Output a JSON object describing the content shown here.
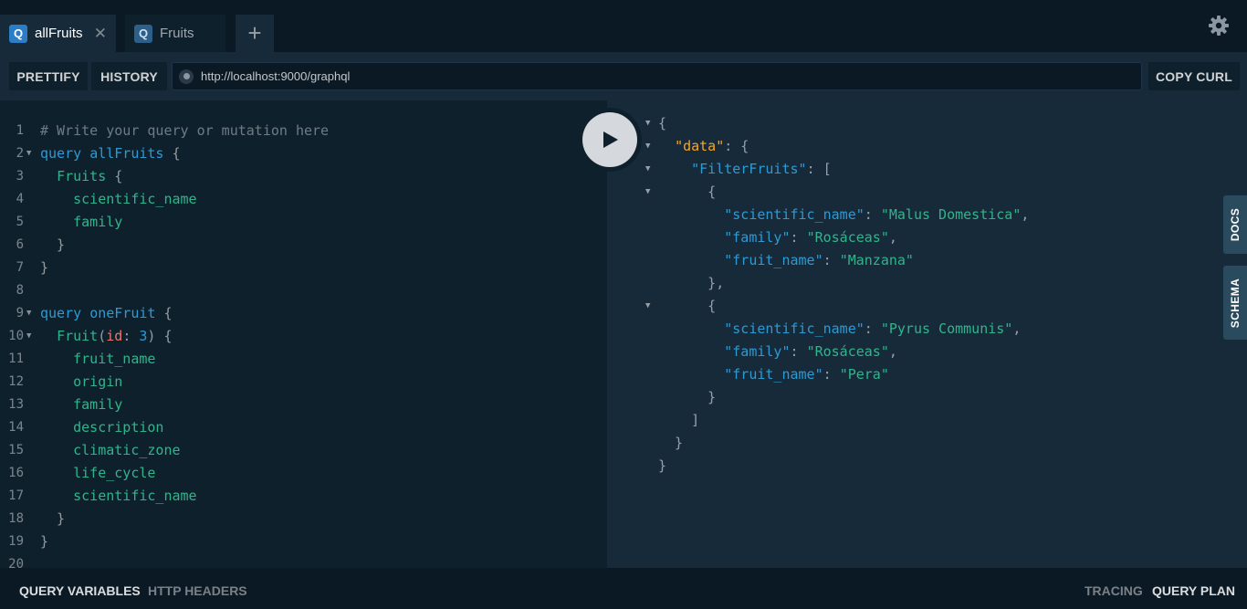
{
  "tabs": [
    {
      "badge": "Q",
      "label": "allFruits",
      "close": "✕"
    },
    {
      "badge": "Q",
      "label": "Fruits"
    }
  ],
  "add_tab": "+",
  "toolbar": {
    "prettify": "PRETTIFY",
    "history": "HISTORY",
    "url": "http://localhost:9000/graphql",
    "copy_curl": "COPY CURL"
  },
  "side_tabs": {
    "docs": "DOCS",
    "schema": "SCHEMA"
  },
  "bottom": {
    "query_variables": "QUERY VARIABLES",
    "http_headers": "HTTP HEADERS",
    "tracing": "TRACING",
    "query_plan": "QUERY PLAN"
  },
  "editor_lines": [
    {
      "n": "1",
      "fold": false,
      "tokens": [
        [
          "cmt",
          "# Write your query or mutation here"
        ]
      ]
    },
    {
      "n": "2",
      "fold": true,
      "tokens": [
        [
          "kw",
          "query"
        ],
        [
          "punc",
          " "
        ],
        [
          "def",
          "allFruits"
        ],
        [
          "punc",
          " {"
        ]
      ]
    },
    {
      "n": "3",
      "fold": false,
      "tokens": [
        [
          "punc",
          "  "
        ],
        [
          "fld",
          "Fruits"
        ],
        [
          "punc",
          " {"
        ]
      ]
    },
    {
      "n": "4",
      "fold": false,
      "tokens": [
        [
          "punc",
          "    "
        ],
        [
          "fld",
          "scientific_name"
        ]
      ]
    },
    {
      "n": "5",
      "fold": false,
      "tokens": [
        [
          "punc",
          "    "
        ],
        [
          "fld",
          "family"
        ]
      ]
    },
    {
      "n": "6",
      "fold": false,
      "tokens": [
        [
          "punc",
          "  }"
        ]
      ]
    },
    {
      "n": "7",
      "fold": false,
      "tokens": [
        [
          "punc",
          "}"
        ]
      ]
    },
    {
      "n": "8",
      "fold": false,
      "tokens": []
    },
    {
      "n": "9",
      "fold": true,
      "tokens": [
        [
          "kw",
          "query"
        ],
        [
          "punc",
          " "
        ],
        [
          "def",
          "oneFruit"
        ],
        [
          "punc",
          " {"
        ]
      ]
    },
    {
      "n": "10",
      "fold": true,
      "tokens": [
        [
          "punc",
          "  "
        ],
        [
          "fld",
          "Fruit"
        ],
        [
          "punc",
          "("
        ],
        [
          "arg",
          "id"
        ],
        [
          "punc",
          ": "
        ],
        [
          "num",
          "3"
        ],
        [
          "punc",
          ") {"
        ]
      ]
    },
    {
      "n": "11",
      "fold": false,
      "tokens": [
        [
          "punc",
          "    "
        ],
        [
          "fld",
          "fruit_name"
        ]
      ]
    },
    {
      "n": "12",
      "fold": false,
      "tokens": [
        [
          "punc",
          "    "
        ],
        [
          "fld",
          "origin"
        ]
      ]
    },
    {
      "n": "13",
      "fold": false,
      "tokens": [
        [
          "punc",
          "    "
        ],
        [
          "fld",
          "family"
        ]
      ]
    },
    {
      "n": "14",
      "fold": false,
      "tokens": [
        [
          "punc",
          "    "
        ],
        [
          "fld",
          "description"
        ]
      ]
    },
    {
      "n": "15",
      "fold": false,
      "tokens": [
        [
          "punc",
          "    "
        ],
        [
          "fld",
          "climatic_zone"
        ]
      ]
    },
    {
      "n": "16",
      "fold": false,
      "tokens": [
        [
          "punc",
          "    "
        ],
        [
          "fld",
          "life_cycle"
        ]
      ]
    },
    {
      "n": "17",
      "fold": false,
      "tokens": [
        [
          "punc",
          "    "
        ],
        [
          "fld",
          "scientific_name"
        ]
      ]
    },
    {
      "n": "18",
      "fold": false,
      "tokens": [
        [
          "punc",
          "  }"
        ]
      ]
    },
    {
      "n": "19",
      "fold": false,
      "tokens": [
        [
          "punc",
          "}"
        ]
      ]
    },
    {
      "n": "20",
      "fold": false,
      "tokens": []
    }
  ],
  "result_lines": [
    {
      "fold": true,
      "tokens": [
        [
          "punc",
          "{"
        ]
      ]
    },
    {
      "fold": true,
      "tokens": [
        [
          "punc",
          "  "
        ],
        [
          "rkeyo",
          "\"data\""
        ],
        [
          "punc",
          ": {"
        ]
      ]
    },
    {
      "fold": true,
      "tokens": [
        [
          "punc",
          "    "
        ],
        [
          "rkey",
          "\"FilterFruits\""
        ],
        [
          "punc",
          ": ["
        ]
      ]
    },
    {
      "fold": true,
      "tokens": [
        [
          "punc",
          "      {"
        ]
      ]
    },
    {
      "fold": false,
      "tokens": [
        [
          "punc",
          "        "
        ],
        [
          "rkey",
          "\"scientific_name\""
        ],
        [
          "punc",
          ": "
        ],
        [
          "rstr",
          "\"Malus Domestica\""
        ],
        [
          "punc",
          ","
        ]
      ]
    },
    {
      "fold": false,
      "tokens": [
        [
          "punc",
          "        "
        ],
        [
          "rkey",
          "\"family\""
        ],
        [
          "punc",
          ": "
        ],
        [
          "rstr",
          "\"Rosáceas\""
        ],
        [
          "punc",
          ","
        ]
      ]
    },
    {
      "fold": false,
      "tokens": [
        [
          "punc",
          "        "
        ],
        [
          "rkey",
          "\"fruit_name\""
        ],
        [
          "punc",
          ": "
        ],
        [
          "rstr",
          "\"Manzana\""
        ]
      ]
    },
    {
      "fold": false,
      "tokens": [
        [
          "punc",
          "      },"
        ]
      ]
    },
    {
      "fold": true,
      "tokens": [
        [
          "punc",
          "      {"
        ]
      ]
    },
    {
      "fold": false,
      "tokens": [
        [
          "punc",
          "        "
        ],
        [
          "rkey",
          "\"scientific_name\""
        ],
        [
          "punc",
          ": "
        ],
        [
          "rstr",
          "\"Pyrus Communis\""
        ],
        [
          "punc",
          ","
        ]
      ]
    },
    {
      "fold": false,
      "tokens": [
        [
          "punc",
          "        "
        ],
        [
          "rkey",
          "\"family\""
        ],
        [
          "punc",
          ": "
        ],
        [
          "rstr",
          "\"Rosáceas\""
        ],
        [
          "punc",
          ","
        ]
      ]
    },
    {
      "fold": false,
      "tokens": [
        [
          "punc",
          "        "
        ],
        [
          "rkey",
          "\"fruit_name\""
        ],
        [
          "punc",
          ": "
        ],
        [
          "rstr",
          "\"Pera\""
        ]
      ]
    },
    {
      "fold": false,
      "tokens": [
        [
          "punc",
          "      }"
        ]
      ]
    },
    {
      "fold": false,
      "tokens": [
        [
          "punc",
          "    ]"
        ]
      ]
    },
    {
      "fold": false,
      "tokens": [
        [
          "punc",
          "  }"
        ]
      ]
    },
    {
      "fold": false,
      "tokens": [
        [
          "punc",
          "}"
        ]
      ]
    }
  ],
  "icons": {
    "settings": "gear-icon",
    "run": "play-icon",
    "fold": "fold-arrow-icon"
  },
  "colors": {
    "background": "#0f202d",
    "panel": "#172a3a",
    "keyword": "#2b9bd5",
    "field": "#2fb58c",
    "string": "#2fb58c",
    "argument": "#f0756b",
    "data_key": "#f6a623"
  }
}
